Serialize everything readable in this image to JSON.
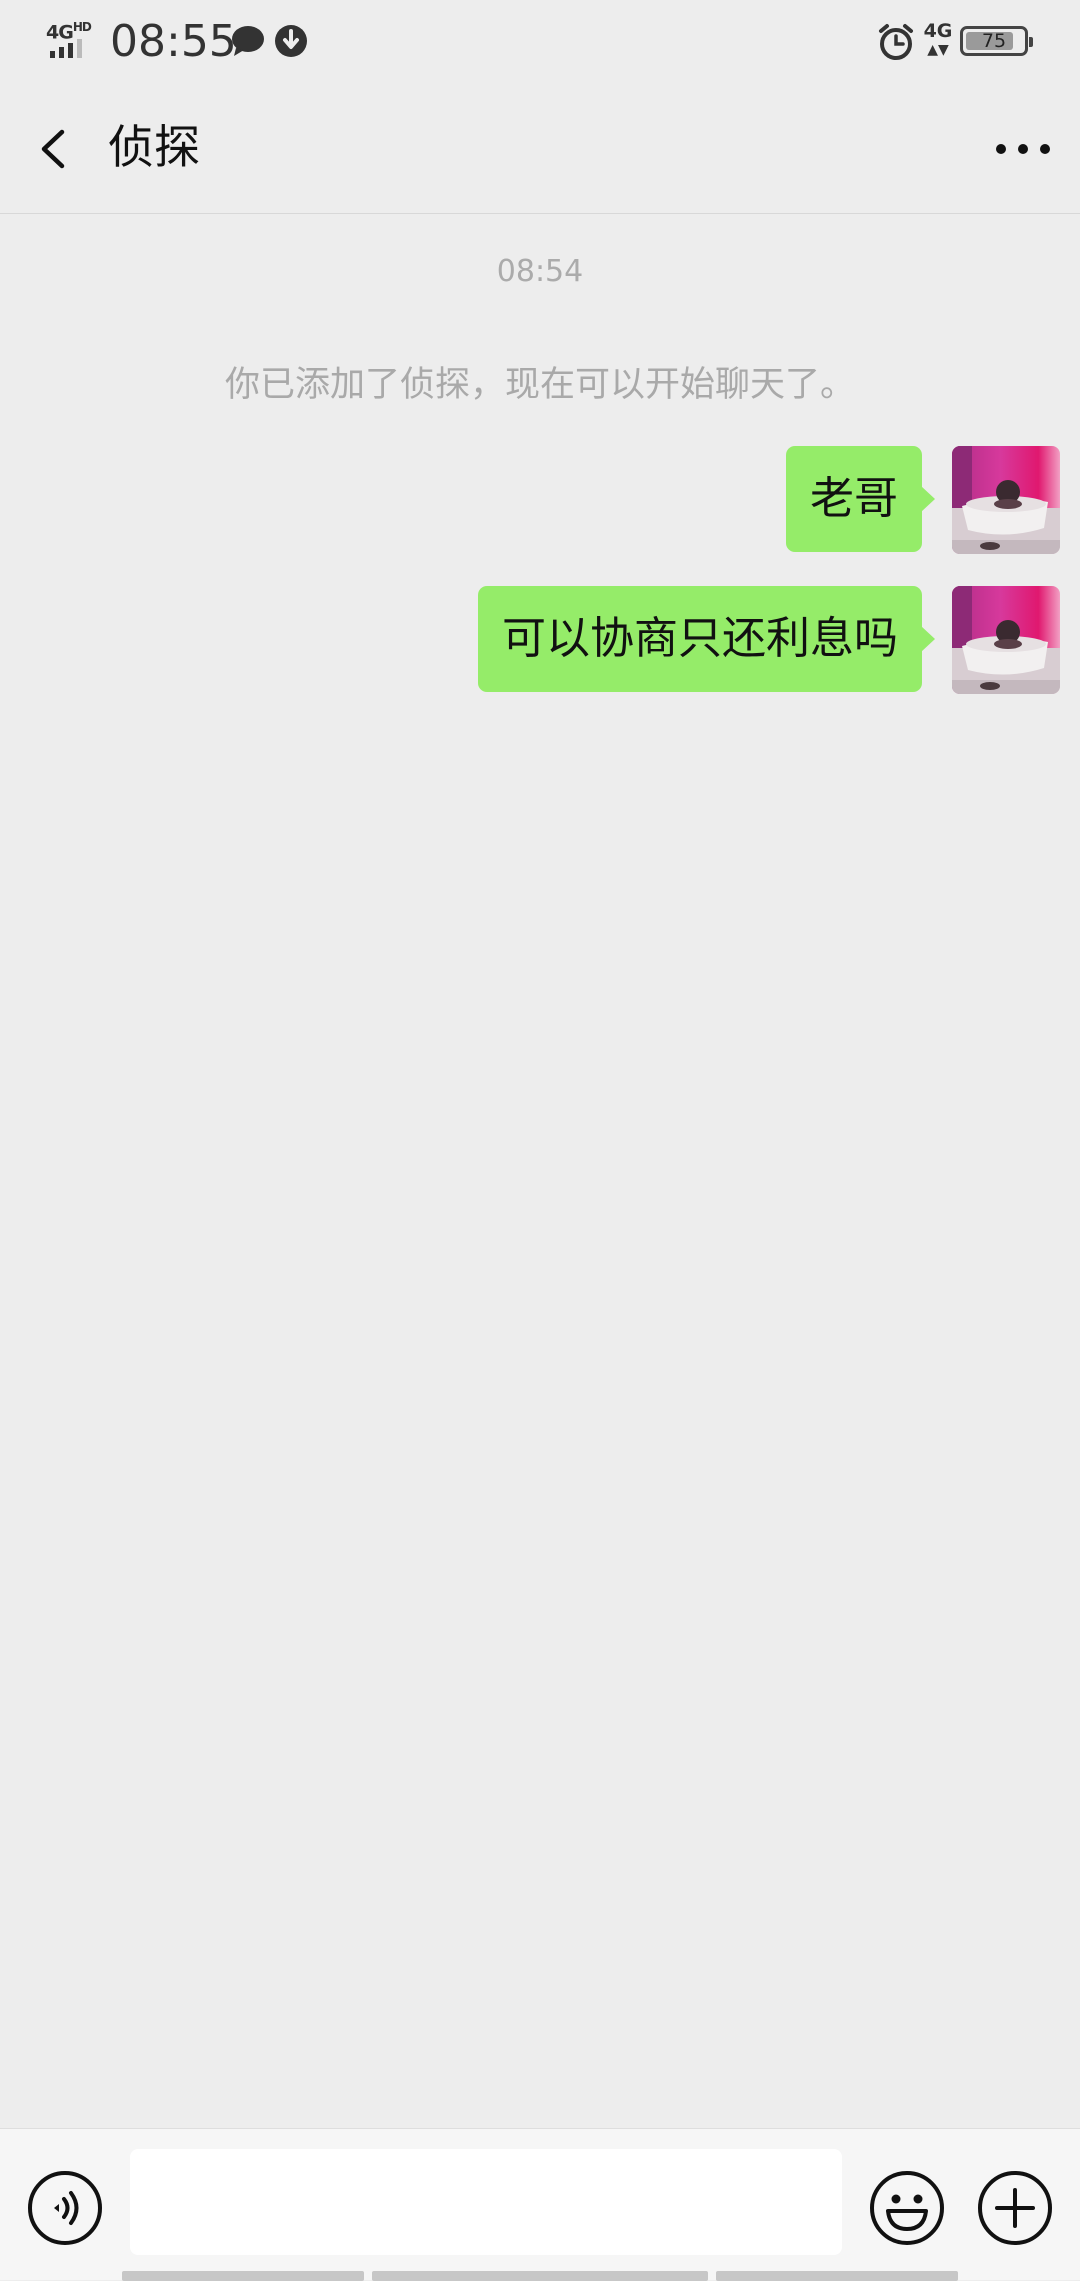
{
  "status_bar": {
    "network_left": "4G",
    "network_left_sup": "HD",
    "time": "08:55",
    "network_right": "4G",
    "battery_level": "75",
    "battery_fraction": 0.75
  },
  "header": {
    "title": "侦探"
  },
  "messages": {
    "timestamp": "08:54",
    "system_notice": "你已添加了侦探，现在可以开始聊天了。",
    "sent": [
      {
        "text": "老哥"
      },
      {
        "text": "可以协商只还利息吗"
      }
    ]
  },
  "input_bar": {
    "input_value": "",
    "input_placeholder": ""
  },
  "colors": {
    "background": "#ededed",
    "sent_bubble": "#95ec69",
    "meta_text": "#ababab",
    "input_bar": "#f6f6f6"
  },
  "icons": {
    "back": "chevron-left-icon",
    "more": "more-dots-icon",
    "voice": "voice-icon",
    "emoji": "emoji-icon",
    "plus": "plus-icon"
  }
}
